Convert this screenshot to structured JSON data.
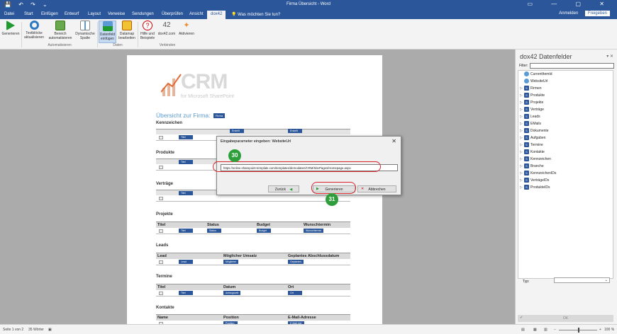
{
  "window": {
    "title": "Firma Übersicht - Word",
    "quick_access": "💾 ↶ ↷ ⌄",
    "window_controls": "▭ — ▢ ✕"
  },
  "tabs": [
    {
      "label": "Datei"
    },
    {
      "label": "Start"
    },
    {
      "label": "Einfügen"
    },
    {
      "label": "Entwurf"
    },
    {
      "label": "Layout"
    },
    {
      "label": "Verweise"
    },
    {
      "label": "Sendungen"
    },
    {
      "label": "Überprüfen"
    },
    {
      "label": "Ansicht"
    },
    {
      "label": "dox42"
    }
  ],
  "tellme": "💡 Was möchten Sie tun?",
  "signin": "Anmelden",
  "share": "Freigeben",
  "ribbon": {
    "buttons": [
      {
        "label": "Generieren",
        "icon": "play-icon"
      },
      {
        "label": "Textblöcke aktualisieren",
        "icon": "refresh-icon"
      },
      {
        "label": "Bereich automatisieren",
        "icon": "area-icon"
      },
      {
        "label": "Dynamische Spalte",
        "icon": "column-icon"
      },
      {
        "label": "Datenfeld einfügen",
        "icon": "insert-field-icon"
      },
      {
        "label": "Datamap bearbeiten",
        "icon": "datamap-icon"
      },
      {
        "label": "Hilfe und Beispiele",
        "icon": "help-icon"
      },
      {
        "label": "dox42.com",
        "icon": "dox42-icon"
      },
      {
        "label": "Aktivieren",
        "icon": "key-icon"
      }
    ],
    "groups": [
      "Automatisieren",
      "Daten",
      "Verbinden"
    ]
  },
  "document": {
    "logo_text": "CRM",
    "logo_sub": "for Microsoft SharePoint",
    "heading": "Übersicht zur Firma:",
    "heading_field": "Firma",
    "sections": {
      "kennzeichen": {
        "title": "Kennzeichen",
        "fields": [
          "Titel",
          "Erstellt",
          "Erstellt"
        ]
      },
      "produkte": {
        "title": "Produkte",
        "fields": [
          "Titel"
        ]
      },
      "vertraege": {
        "title": "Verträge",
        "fields": [
          "Titel"
        ]
      },
      "projekte": {
        "title": "Projekte",
        "headers": [
          "Titel",
          "Status",
          "Budget",
          "Wunschtermin"
        ],
        "fields": [
          "Titel",
          "Status",
          "Budget",
          "Wunschtermin"
        ]
      },
      "leads": {
        "title": "Leads",
        "headers": [
          "Lead",
          "Möglicher Umsatz",
          "Geplantes Abschlussdatum"
        ],
        "fields": [
          "Lead",
          "Möglicher",
          "Geplantes"
        ]
      },
      "termine": {
        "title": "Termine",
        "headers": [
          "Titel",
          "Datum",
          "Ort"
        ],
        "fields": [
          "Titel",
          "Anfangszeit",
          "Ort"
        ]
      },
      "kontakte": {
        "title": "Kontakte",
        "headers": [
          "Name",
          "Position",
          "E-Mail-Adresse"
        ],
        "fields": [
          "",
          "Position",
          "E-Mail-Adr"
        ]
      }
    }
  },
  "dialog": {
    "title": "Eingabeparameter eingeben: WebsiteUrl",
    "close": "✕",
    "url_value": "https://online.sharepoint-template.com/templates/demodaten/CRM/SitePages/Homepage.aspx",
    "back_label": "Zurück",
    "generate_label": "Generieren",
    "cancel_label": "Abbrechen",
    "callout_input": "30",
    "callout_generate": "31",
    "accent": "#d9242b",
    "callout_color": "#2e9e3a"
  },
  "pane": {
    "title": "dox42 Datenfelder",
    "controls": "▾ ✕",
    "filter_label": "Filter:",
    "filter_value": "",
    "items": [
      {
        "label": "CurrentItemId",
        "kind": "field"
      },
      {
        "label": "WebsiteUrl",
        "kind": "field"
      },
      {
        "label": "Firmen",
        "kind": "list"
      },
      {
        "label": "Produkte",
        "kind": "list"
      },
      {
        "label": "Projekte",
        "kind": "list"
      },
      {
        "label": "Verträge",
        "kind": "list"
      },
      {
        "label": "Leads",
        "kind": "list"
      },
      {
        "label": "EMails",
        "kind": "list"
      },
      {
        "label": "Dokumente",
        "kind": "list"
      },
      {
        "label": "Aufgaben",
        "kind": "list"
      },
      {
        "label": "Termine",
        "kind": "list"
      },
      {
        "label": "Kontakte",
        "kind": "list"
      },
      {
        "label": "Kennzeichen",
        "kind": "list"
      },
      {
        "label": "Branche",
        "kind": "list"
      },
      {
        "label": "KennzeichenIDs",
        "kind": "list"
      },
      {
        "label": "VerträgeIDs",
        "kind": "list"
      },
      {
        "label": "ProdukteIDs",
        "kind": "list"
      }
    ],
    "type_label": "Typ:",
    "type_value": "⌄",
    "ok_label": "OK"
  },
  "statusbar": {
    "page": "Seite 1 von 2",
    "words": "35 Wörter",
    "zoom": "100 %",
    "zoom_minus": "−",
    "zoom_plus": "+"
  },
  "colors": {
    "brand": "#2b579a",
    "heading": "#5b9bd5"
  }
}
